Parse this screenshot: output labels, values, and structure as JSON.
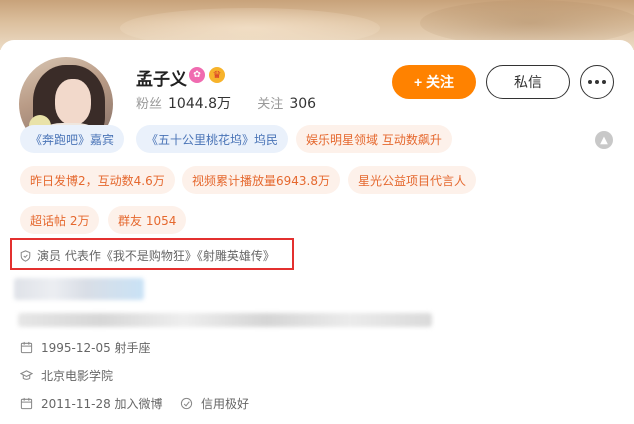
{
  "profile": {
    "name": "孟子义",
    "verify_mark": "V",
    "followers_label": "粉丝",
    "followers_value": "1044.8万",
    "following_label": "关注",
    "following_value": "306"
  },
  "actions": {
    "follow_label": "+ 关注",
    "message_label": "私信"
  },
  "tags": {
    "row1": [
      "《奔跑吧》嘉宾",
      "《五十公里桃花坞》坞民",
      "娱乐明星领域 互动数飙升"
    ],
    "row2": [
      "昨日发博2，互动数4.6万",
      "视频累计播放量6943.8万",
      "星光公益项目代言人"
    ],
    "row3": [
      "超话帖 2万",
      "群友 1054"
    ]
  },
  "certification": "演员 代表作《我不是购物狂》《射雕英雄传》",
  "info": {
    "birthday": "1995-12-05 射手座",
    "school": "北京电影学院",
    "joined": "2011-11-28 加入微博",
    "credit": "信用极好"
  },
  "colors": {
    "accent": "#ff8200",
    "tag_blue_text": "#4a74b7",
    "tag_orange_text": "#e5682e",
    "highlight_box": "#e3302f"
  }
}
